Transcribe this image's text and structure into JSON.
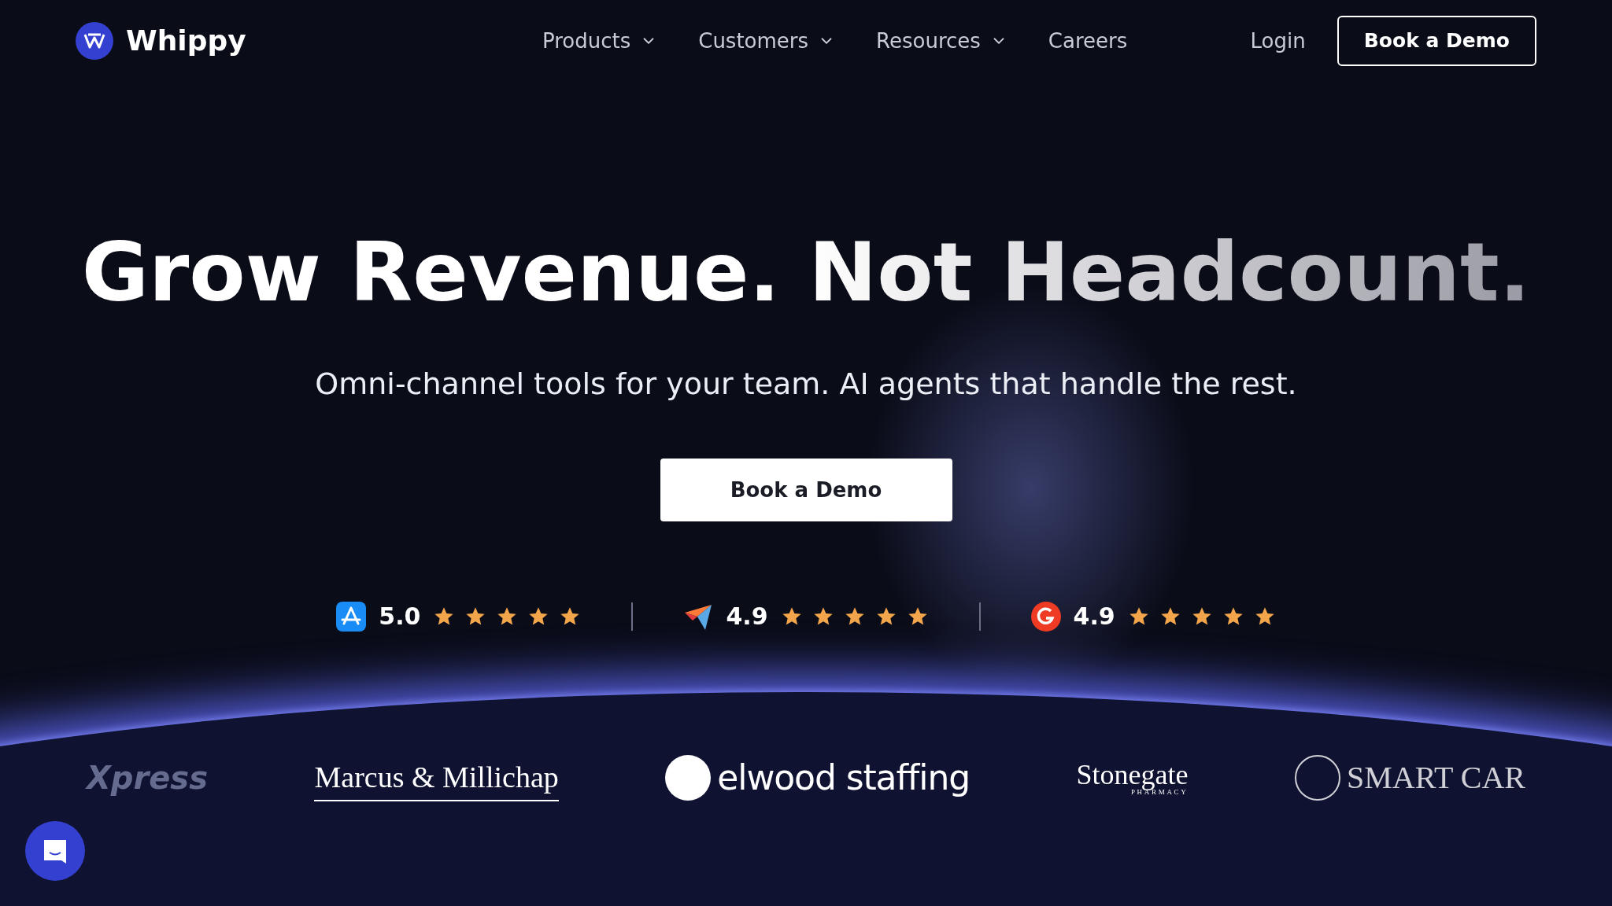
{
  "nav": {
    "brand": "Whippy",
    "links": [
      {
        "label": "Products",
        "dropdown": true
      },
      {
        "label": "Customers",
        "dropdown": true
      },
      {
        "label": "Resources",
        "dropdown": true
      },
      {
        "label": "Careers",
        "dropdown": false
      }
    ],
    "login": "Login",
    "cta": "Book a Demo"
  },
  "hero": {
    "headline_lead": "Grow Revenue.",
    "headline_tail": "Not Headcount.",
    "subtitle": "Omni-channel tools for your team. AI agents that handle the rest.",
    "cta": "Book a Demo"
  },
  "ratings": [
    {
      "kind": "appstore",
      "score": "5.0",
      "stars": 5
    },
    {
      "kind": "capterra",
      "score": "4.9",
      "stars": 5
    },
    {
      "kind": "g2",
      "score": "4.9",
      "stars": 5
    }
  ],
  "logos": [
    {
      "kind": "xpress",
      "text": "Xpress"
    },
    {
      "kind": "marcus",
      "text": "Marcus & Millichap"
    },
    {
      "kind": "elwood",
      "text": "elwood staffing"
    },
    {
      "kind": "stonegate",
      "text": "Stonegate",
      "sub": "PHARMACY"
    },
    {
      "kind": "smart",
      "text": "SMART CAR"
    }
  ]
}
